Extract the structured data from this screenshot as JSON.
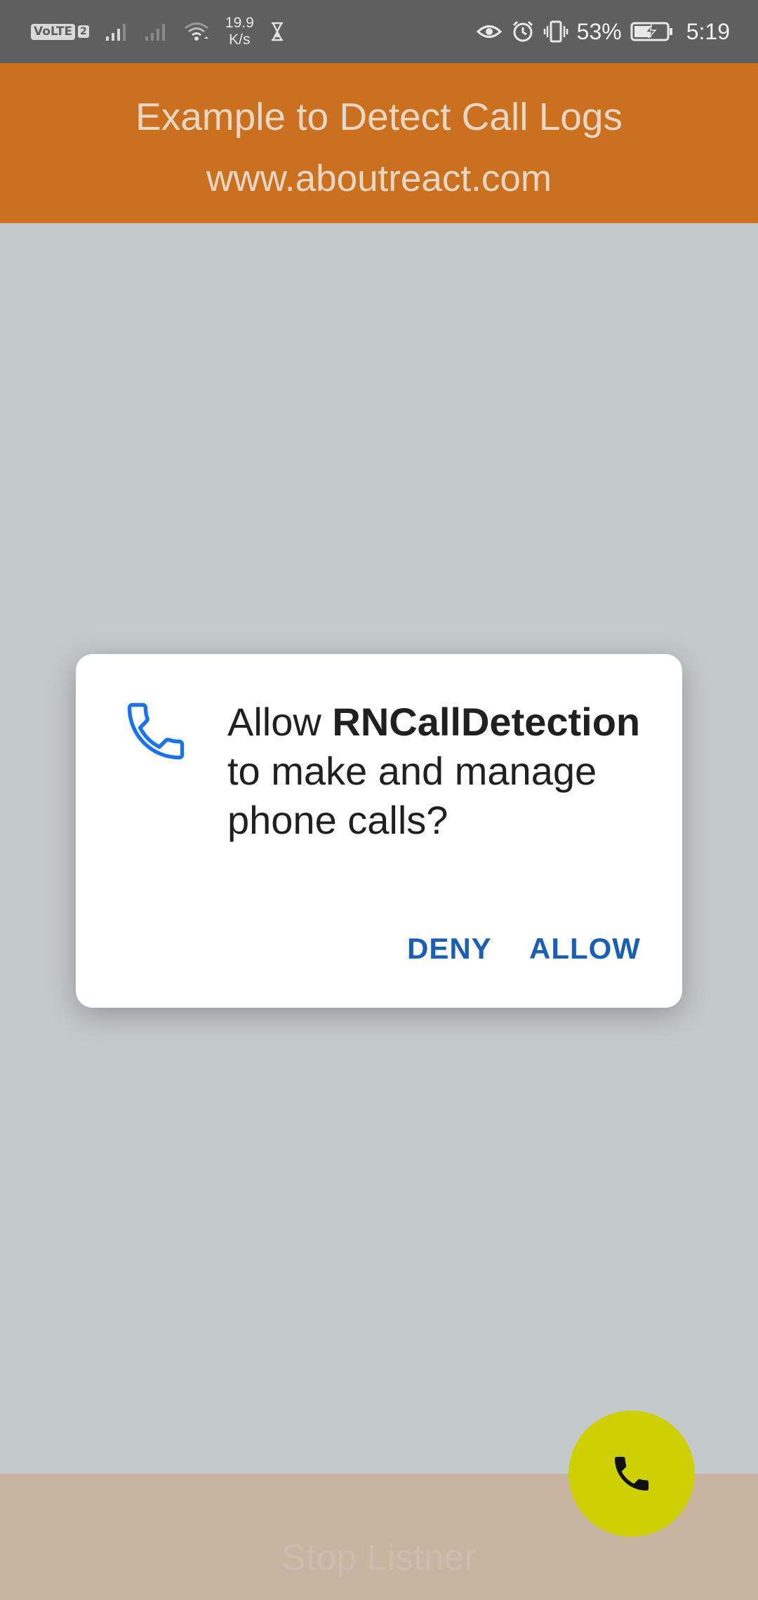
{
  "status_bar": {
    "volte_label": "VoLTE",
    "sim_number": "2",
    "net_speed_value": "19.9",
    "net_speed_unit": "K/s",
    "battery_percent": "53%",
    "time": "5:19",
    "icons": [
      "signal-icon",
      "signal-weak-icon",
      "wifi-icon",
      "hourglass-icon",
      "eye-icon",
      "alarm-icon",
      "vibrate-icon",
      "battery-charging-icon"
    ]
  },
  "header": {
    "title": "Example to Detect Call Logs",
    "url": "www.aboutreact.com",
    "background": "#ca701f"
  },
  "dialog": {
    "message_prefix": "Allow ",
    "app_name": "RNCallDetection",
    "message_suffix": " to make and manage phone calls?",
    "deny_label": "DENY",
    "allow_label": "ALLOW",
    "icon": "phone-outline-icon",
    "accent_color": "#1a5fb4"
  },
  "bottom": {
    "stop_label": "Stop Listner",
    "background": "#c9b3a1"
  },
  "fab": {
    "icon": "phone-icon",
    "color": "#cfcf03"
  }
}
